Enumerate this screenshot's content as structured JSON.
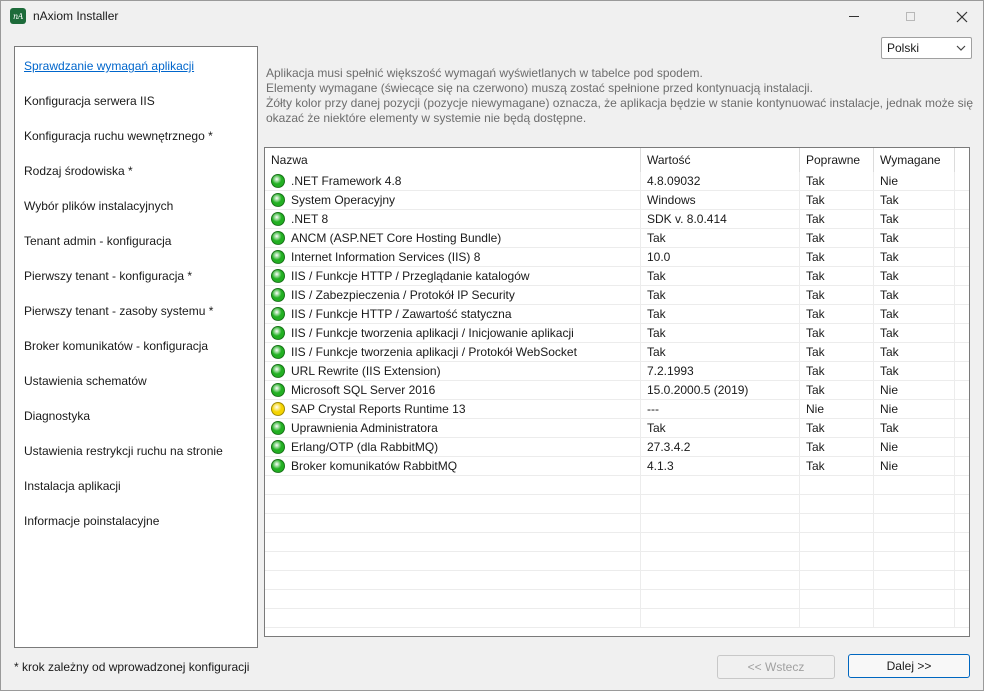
{
  "window": {
    "title": "nAxiom Installer",
    "icon_text": "nA",
    "icon_color": "#1d6b3a"
  },
  "language": {
    "selected": "Polski"
  },
  "sidebar": {
    "items": [
      {
        "label": "Sprawdzanie wymagań aplikacji",
        "active": true
      },
      {
        "label": "Konfiguracja serwera IIS"
      },
      {
        "label": "Konfiguracja ruchu wewnętrznego *"
      },
      {
        "label": "Rodzaj środowiska *"
      },
      {
        "label": "Wybór plików instalacyjnych"
      },
      {
        "label": "Tenant admin - konfiguracja"
      },
      {
        "label": "Pierwszy tenant - konfiguracja *"
      },
      {
        "label": "Pierwszy tenant - zasoby systemu *"
      },
      {
        "label": "Broker komunikatów - konfiguracja"
      },
      {
        "label": "Ustawienia schematów"
      },
      {
        "label": "Diagnostyka"
      },
      {
        "label": "Ustawienia restrykcji ruchu na stronie"
      },
      {
        "label": "Instalacja aplikacji"
      },
      {
        "label": "Informacje poinstalacyjne"
      }
    ]
  },
  "footnote": "* krok zależny od wprowadzonej konfiguracji",
  "description": [
    "Aplikacja musi spełnić większość wymagań wyświetlanych w tabelce pod spodem.",
    "Elementy wymagane (świecące się na czerwono) muszą zostać spełnione przed kontynuacją instalacji.",
    "Żółty kolor przy danej pozycji (pozycje niewymagane) oznacza, że aplikacja będzie w stanie kontynuować instalacje, jednak może się okazać że niektóre elementy w systemie nie będą dostępne."
  ],
  "status_colors": {
    "ok": "#22b022",
    "warn": "#f5d400"
  },
  "table": {
    "columns": [
      "Nazwa",
      "Wartość",
      "Poprawne",
      "Wymagane"
    ],
    "rows": [
      {
        "status": "ok",
        "name": ".NET Framework 4.8",
        "value": "4.8.09032",
        "ok": "Tak",
        "req": "Nie"
      },
      {
        "status": "ok",
        "name": "System Operacyjny",
        "value": "Windows",
        "ok": "Tak",
        "req": "Tak"
      },
      {
        "status": "ok",
        "name": ".NET 8",
        "value": "SDK v. 8.0.414",
        "ok": "Tak",
        "req": "Tak"
      },
      {
        "status": "ok",
        "name": "ANCM (ASP.NET Core Hosting Bundle)",
        "value": "Tak",
        "ok": "Tak",
        "req": "Tak"
      },
      {
        "status": "ok",
        "name": "Internet Information Services (IIS) 8",
        "value": "10.0",
        "ok": "Tak",
        "req": "Tak"
      },
      {
        "status": "ok",
        "name": "IIS / Funkcje HTTP / Przeglądanie katalogów",
        "value": "Tak",
        "ok": "Tak",
        "req": "Tak"
      },
      {
        "status": "ok",
        "name": "IIS / Zabezpieczenia / Protokół IP Security",
        "value": "Tak",
        "ok": "Tak",
        "req": "Tak"
      },
      {
        "status": "ok",
        "name": "IIS / Funkcje HTTP / Zawartość statyczna",
        "value": "Tak",
        "ok": "Tak",
        "req": "Tak"
      },
      {
        "status": "ok",
        "name": "IIS / Funkcje tworzenia aplikacji / Inicjowanie aplikacji",
        "value": "Tak",
        "ok": "Tak",
        "req": "Tak"
      },
      {
        "status": "ok",
        "name": "IIS / Funkcje tworzenia aplikacji / Protokół WebSocket",
        "value": "Tak",
        "ok": "Tak",
        "req": "Tak"
      },
      {
        "status": "ok",
        "name": "URL Rewrite (IIS Extension)",
        "value": "7.2.1993",
        "ok": "Tak",
        "req": "Tak"
      },
      {
        "status": "ok",
        "name": "Microsoft SQL Server 2016",
        "value": "15.0.2000.5 (2019)",
        "ok": "Tak",
        "req": "Nie"
      },
      {
        "status": "warn",
        "name": "SAP Crystal Reports Runtime 13",
        "value": "---",
        "ok": "Nie",
        "req": "Nie"
      },
      {
        "status": "ok",
        "name": "Uprawnienia Administratora",
        "value": "Tak",
        "ok": "Tak",
        "req": "Tak"
      },
      {
        "status": "ok",
        "name": "Erlang/OTP (dla RabbitMQ)",
        "value": "27.3.4.2",
        "ok": "Tak",
        "req": "Nie"
      },
      {
        "status": "ok",
        "name": "Broker komunikatów RabbitMQ",
        "value": "4.1.3",
        "ok": "Tak",
        "req": "Nie"
      }
    ]
  },
  "buttons": {
    "back": "<< Wstecz",
    "next": "Dalej >>"
  }
}
